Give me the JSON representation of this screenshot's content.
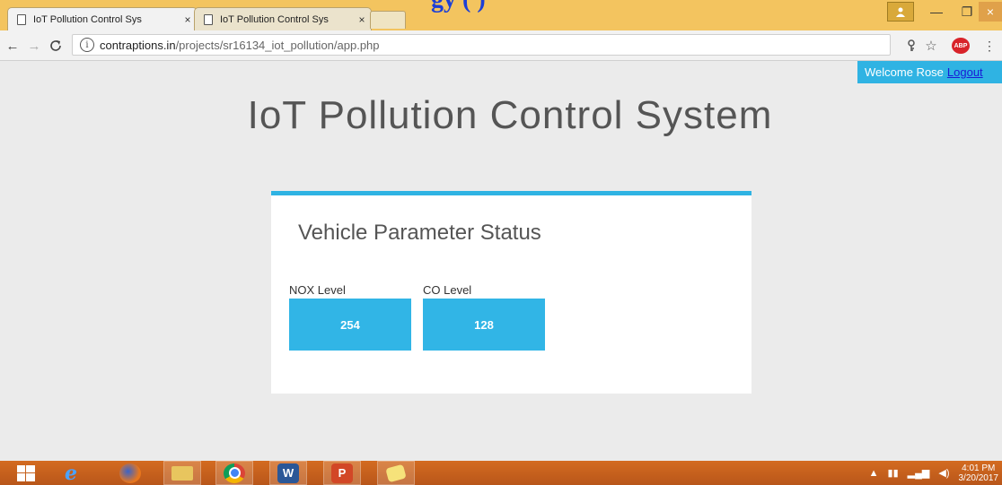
{
  "overlay_title": "gy (        )",
  "browser": {
    "tabs": [
      {
        "label": "IoT Pollution Control Sys",
        "close": "×"
      },
      {
        "label": "IoT Pollution Control Sys",
        "close": "×"
      }
    ],
    "window_controls": {
      "minimize": "—",
      "maximize": "❐",
      "close": "×"
    },
    "url": {
      "host": "contraptions.in",
      "path": "/projects/sr16134_iot_pollution/app.php"
    },
    "abp_label": "ABP"
  },
  "page": {
    "welcome_text": "Welcome Rose",
    "logout_label": "Logout",
    "title": "IoT Pollution Control System",
    "card": {
      "title": "Vehicle Parameter Status",
      "params": [
        {
          "label": "NOX Level",
          "value": "254"
        },
        {
          "label": "CO Level",
          "value": "128"
        }
      ]
    }
  },
  "taskbar": {
    "apps": [
      "windows-start",
      "internet-explorer",
      "firefox",
      "file-explorer",
      "chrome",
      "word",
      "powerpoint",
      "sticky-notes"
    ],
    "clock_time": "4:01 PM",
    "clock_date": "3/20/2017"
  },
  "colors": {
    "accent": "#2fb3e3",
    "tabstrip": "#f3c45f",
    "taskbar": "#c75f1d"
  }
}
